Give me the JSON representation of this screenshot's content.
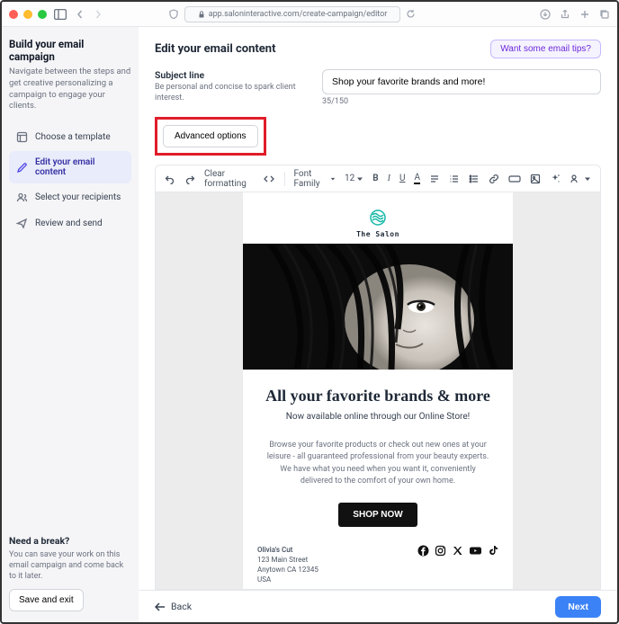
{
  "browser": {
    "url": "app.saloninteractive.com/create-campaign/editor"
  },
  "sidebar": {
    "title": "Build your email campaign",
    "subtitle": "Navigate between the steps and get creative personalizing a campaign to engage your clients.",
    "steps": [
      {
        "label": "Choose a template"
      },
      {
        "label": "Edit your email content"
      },
      {
        "label": "Select your recipients"
      },
      {
        "label": "Review and send"
      }
    ],
    "break_title": "Need a break?",
    "break_sub": "You can save your work on this email campaign and come back to it later.",
    "save_exit": "Save and exit"
  },
  "header": {
    "title": "Edit your email content",
    "tips_btn": "Want some email tips?"
  },
  "subject": {
    "label": "Subject line",
    "hint": "Be personal and concise to spark client interest.",
    "value": "Shop your favorite brands and more!",
    "counter": "35/150"
  },
  "advanced": {
    "label": "Advanced options"
  },
  "toolbar": {
    "clear": "Clear formatting",
    "font_family": "Font Family",
    "font_size": "12"
  },
  "email": {
    "brand_name": "The Salon",
    "headline": "All your favorite brands & more",
    "subhead": "Now available online through our Online Store!",
    "body": "Browse your favorite products or check out new ones at your leisure - all guaranteed professional from your beauty experts. We have what you need when you want it, conveniently delivered to the comfort of your own home.",
    "cta": "SHOP NOW",
    "business": "Olivia's Cut",
    "addr1": "123 Main Street",
    "addr2": "Anytown CA 12345",
    "addr3": "USA"
  },
  "nav": {
    "back": "Back",
    "next": "Next"
  }
}
